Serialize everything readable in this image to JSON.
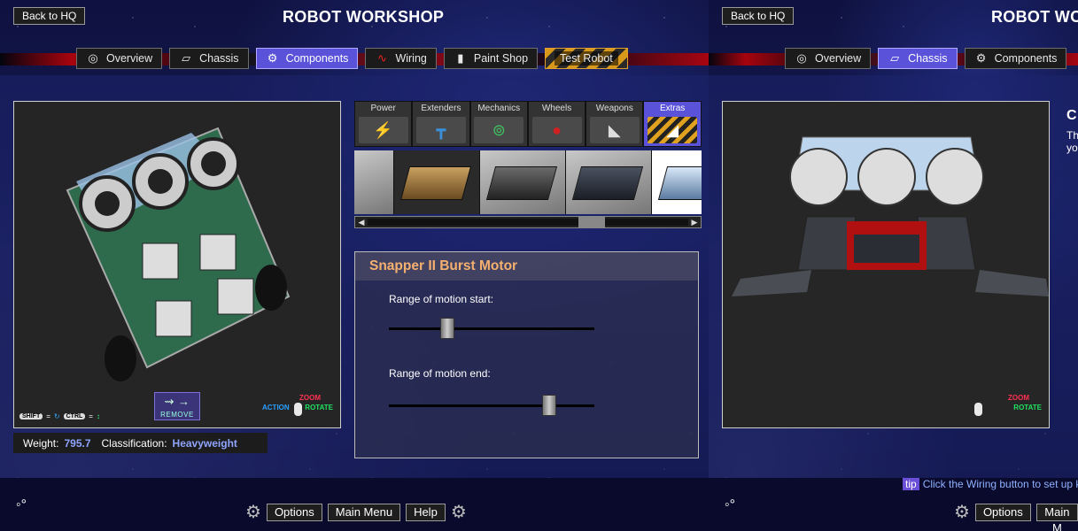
{
  "left": {
    "back_label": "Back to HQ",
    "title": "ROBOT WORKSHOP",
    "tabs": [
      {
        "label": "Overview",
        "icon": "globe-icon"
      },
      {
        "label": "Chassis",
        "icon": "chassis-icon"
      },
      {
        "label": "Components",
        "icon": "gear-icon",
        "active": true
      },
      {
        "label": "Wiring",
        "icon": "wire-icon"
      },
      {
        "label": "Paint Shop",
        "icon": "paint-icon"
      },
      {
        "label": "Test Robot",
        "icon": ""
      }
    ],
    "remove_label": "REMOVE",
    "key_shift": "SHIFT",
    "key_ctrl": "CTRL",
    "mouse": {
      "zoom": "ZOOM",
      "rotate": "ROTATE",
      "action": "ACTION"
    },
    "info": {
      "weight_label": "Weight:",
      "weight_value": "795.7",
      "class_label": "Classification:",
      "class_value": "Heavyweight"
    },
    "categories": [
      "Power",
      "Extenders",
      "Mechanics",
      "Wheels",
      "Weapons",
      "Extras"
    ],
    "active_category": "Extras",
    "panel": {
      "title": "Snapper II Burst Motor",
      "start_label": "Range of motion start:",
      "end_label": "Range of motion end:",
      "start_value": 0.27,
      "end_value": 0.8
    },
    "bottom": {
      "options": "Options",
      "main_menu": "Main Menu",
      "help": "Help"
    }
  },
  "right": {
    "back_label": "Back to HQ",
    "title": "ROBOT WOR",
    "tabs": [
      {
        "label": "Overview",
        "icon": "globe-icon"
      },
      {
        "label": "Chassis",
        "icon": "chassis-icon",
        "active": true
      },
      {
        "label": "Components",
        "icon": "gear-icon"
      }
    ],
    "side_heading": "C",
    "side_line1": "Th",
    "side_line2": "yo",
    "mouse": {
      "zoom": "ZOOM",
      "rotate": "ROTATE"
    },
    "tip_tag": "tip",
    "tip_text": "Click the Wiring button to set up keybo",
    "bottom": {
      "options": "Options",
      "main_menu": "Main M"
    }
  },
  "colors": {
    "accent": "#5a52d8",
    "panel_title": "#f5b070",
    "value": "#8fa4ff",
    "zoom": "#ff3050",
    "rotate": "#20e060",
    "action": "#2a9fff"
  }
}
